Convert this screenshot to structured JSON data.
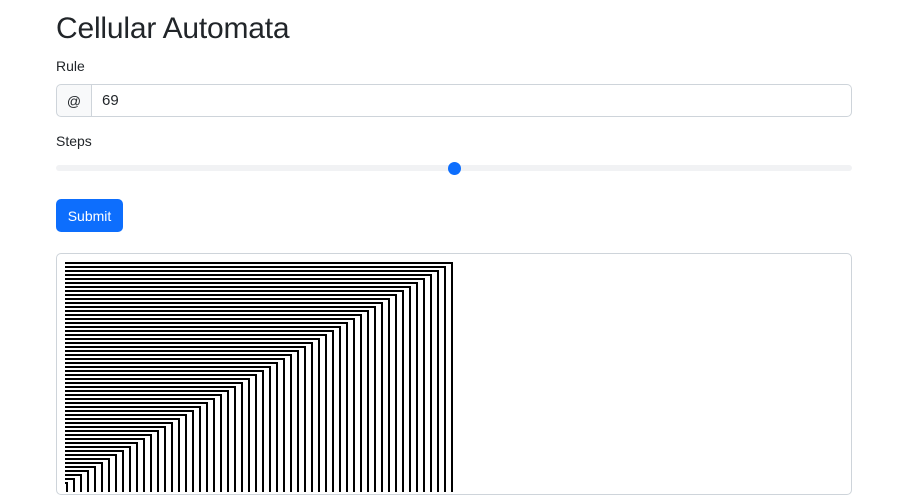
{
  "page": {
    "title": "Cellular Automata"
  },
  "form": {
    "rule_label": "Rule",
    "rule_addon": "@",
    "rule_value": "69",
    "steps_label": "Steps",
    "steps_fraction": 0.5,
    "submit_label": "Submit"
  },
  "colors": {
    "accent": "#0d6efd",
    "cell_on": "#000000",
    "cell_off": "#ffffff"
  }
}
